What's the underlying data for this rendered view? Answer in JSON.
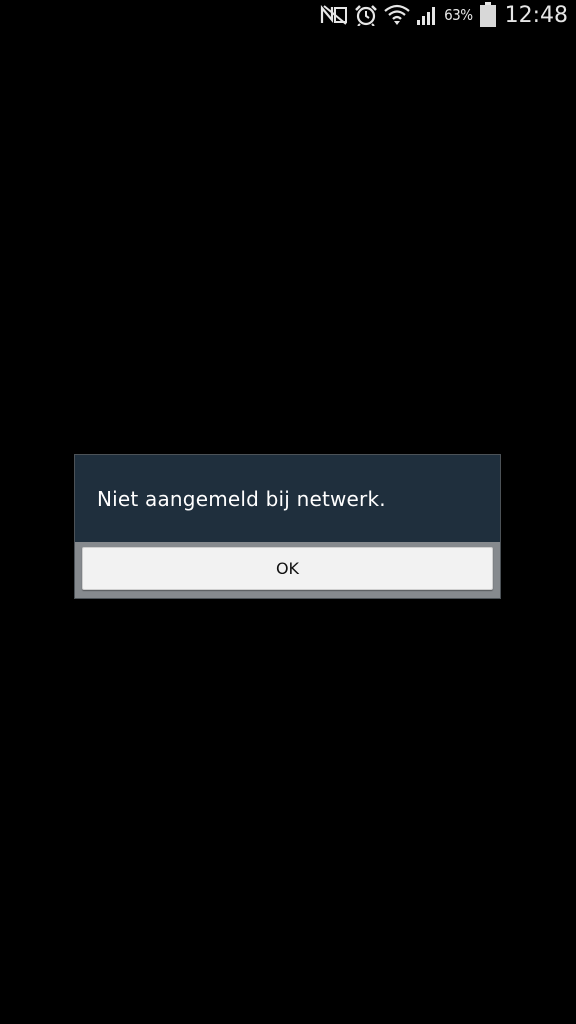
{
  "status_bar": {
    "icons": [
      "nfc-icon",
      "alarm-icon",
      "wifi-icon",
      "signal-icon",
      "battery-icon"
    ],
    "battery_percent": "63%",
    "time": "12:48"
  },
  "dialog": {
    "message": "Niet aangemeld bij netwerk.",
    "ok_label": "OK"
  },
  "colors": {
    "background": "#000000",
    "dialog_body": "#1f2f3d",
    "dialog_footer": "#868a8e",
    "button": "#f2f2f2"
  }
}
